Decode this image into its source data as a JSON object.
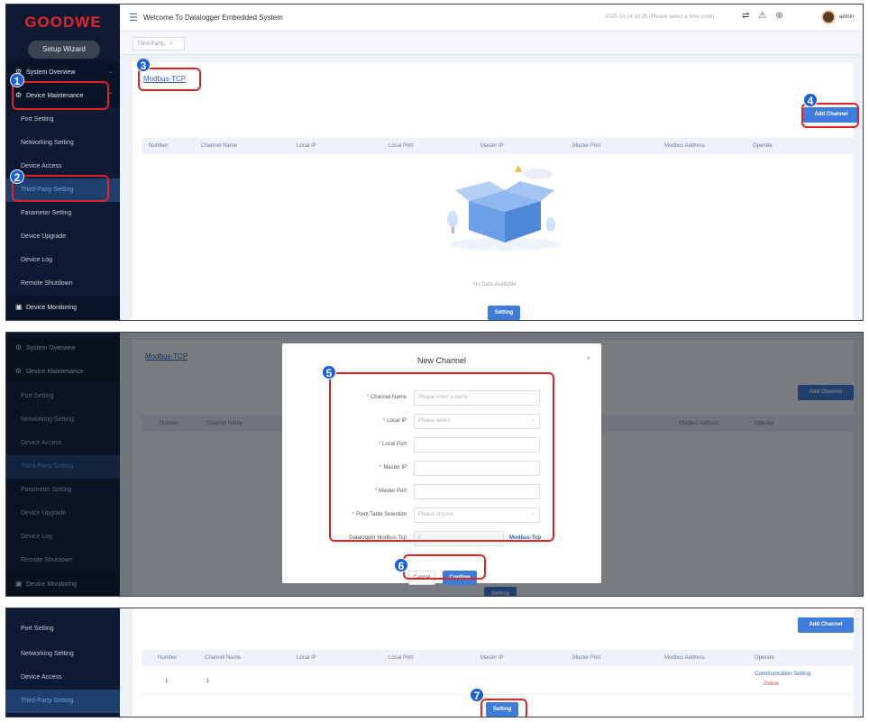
{
  "brand": {
    "logo": "GOODWE",
    "setup_wizard": "Setup Wizard"
  },
  "topbar": {
    "welcome": "Welcome To Datalogger Embedded System",
    "timestamp": "2025-10-14 10:26 (Please select a time zone)",
    "user": "admin",
    "tab": "Third-Party..."
  },
  "sidebar": {
    "system_overview": "System Overview",
    "device_maintenance": "Device Maintenance",
    "port_setting": "Port Setting",
    "networking_setting": "Networking Setting",
    "device_access": "Device Access",
    "third_party_setting": "Third-Party Setting",
    "parameter_setting": "Parameter Setting",
    "device_upgrade": "Device Upgrade",
    "device_log": "Device Log",
    "remote_shutdown": "Remote Shutdown",
    "device_monitoring": "Device Monitoring"
  },
  "content": {
    "modbus_tab": "Modbus-TCP",
    "add_channel": "Add Channel",
    "no_data": "No Data Available",
    "setting": "Setting",
    "columns": [
      "Number",
      "Channel Name",
      "Local IP",
      "Local Port",
      "Master IP",
      "Master Port",
      "Modbus Address",
      "Operate"
    ],
    "row": {
      "number": "1",
      "channel_name": "1",
      "operate_link": "Communication Setting",
      "delete": "Delete"
    }
  },
  "dialog": {
    "title": "New Channel",
    "close": "×",
    "fields": [
      {
        "label": "Channel Name",
        "placeholder": "Please enter a name"
      },
      {
        "label": "Local IP",
        "placeholder": "Please select"
      },
      {
        "label": "Local Port",
        "placeholder": ""
      },
      {
        "label": "Master IP",
        "placeholder": ""
      },
      {
        "label": "Master Port",
        "placeholder": ""
      },
      {
        "label": "Point Table Selection",
        "placeholder": "Please choose"
      }
    ],
    "datalogger_label": "Datalogger Modbus-Tcp",
    "datalogger_value": "0",
    "datalogger_link": "Modbus-Tcp",
    "cancel": "Cancel",
    "confirm": "Confirm"
  },
  "badges": [
    "1",
    "2",
    "3",
    "4",
    "5",
    "6",
    "7"
  ],
  "colors": {
    "accent": "#3f7bd8",
    "highlight": "#e02424",
    "badge": "#1c5fd6",
    "sidebar": "#0e1a33"
  },
  "icons": [
    "menu-icon",
    "gear-icon",
    "chevron-down-icon",
    "monitor-icon",
    "close-icon",
    "bell-icon",
    "network-icon",
    "settings-icon"
  ]
}
